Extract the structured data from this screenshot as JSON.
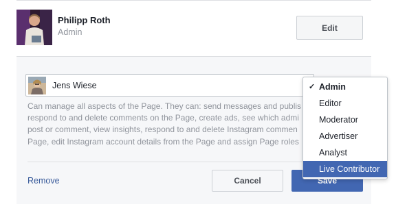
{
  "current_admin": {
    "name": "Philipp Roth",
    "role": "Admin",
    "edit_label": "Edit"
  },
  "new_role": {
    "person_name": "Jens Wiese",
    "description_lines": [
      "Can manage all aspects of the Page. They can: send messages and publis",
      "respond to and delete comments on the Page, create ads, see which admi",
      "post or comment, view insights, respond to and delete Instagram commen",
      "Page, edit Instagram account details from the Page and assign Page roles"
    ],
    "remove_label": "Remove",
    "cancel_label": "Cancel",
    "save_label": "Save"
  },
  "role_dropdown": {
    "selected": "Admin",
    "options": [
      "Admin",
      "Editor",
      "Moderator",
      "Advertiser",
      "Analyst",
      "Live Contributor"
    ],
    "highlighted": "Live Contributor"
  },
  "colors": {
    "accent": "#4267b2",
    "link": "#365899",
    "muted_text": "#90949c"
  }
}
